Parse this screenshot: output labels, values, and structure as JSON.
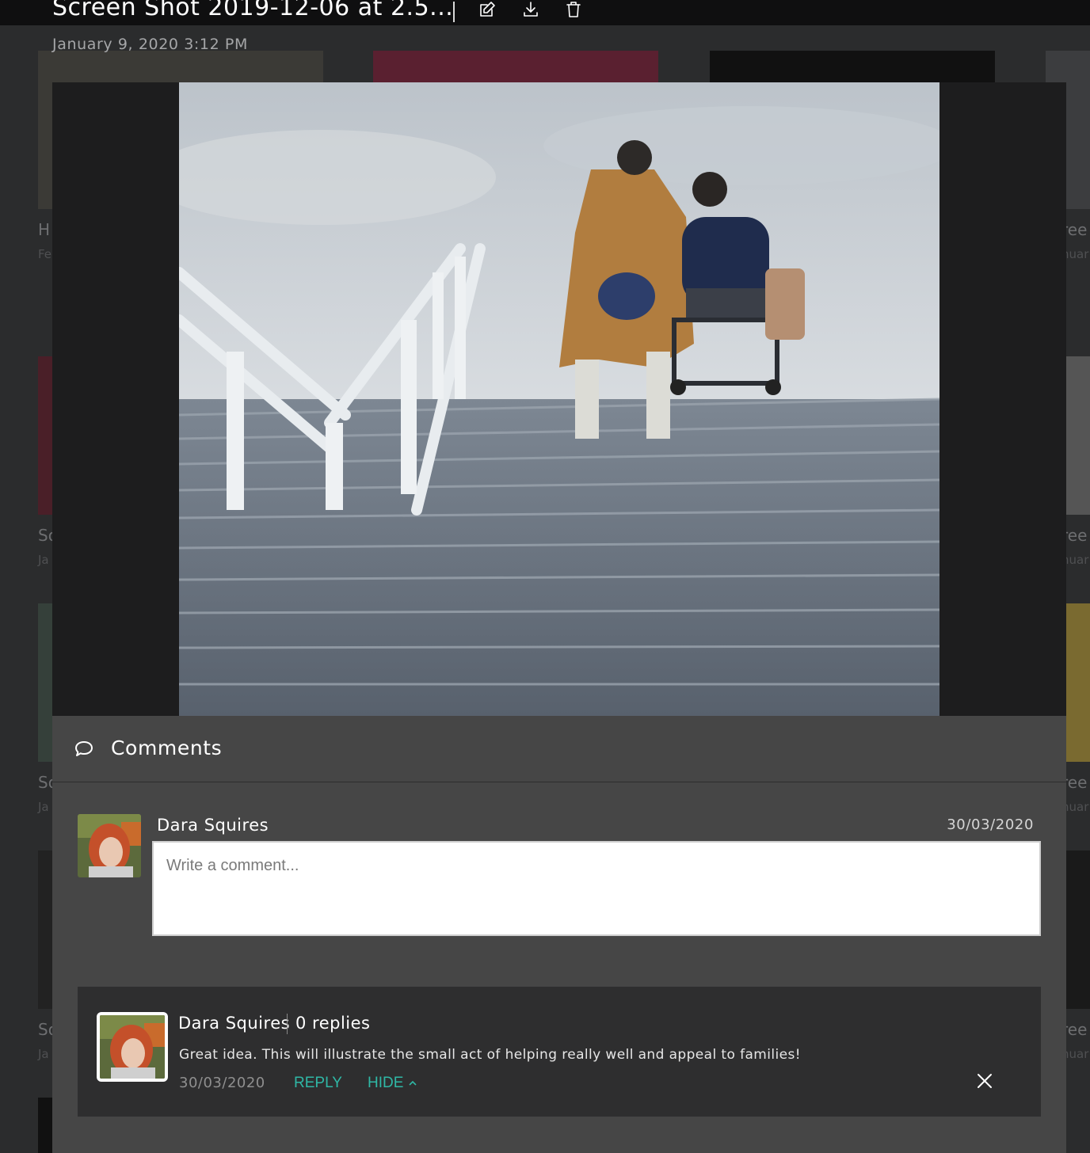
{
  "topbar": {
    "file_title": "Screen Shot 2019-12-06 at 2.5...",
    "edit_icon": "edit-icon",
    "download_icon": "download-icon",
    "delete_icon": "trash-icon"
  },
  "file": {
    "date": "January 9, 2020 3:12 PM"
  },
  "viewer": {
    "image_alt": "photo"
  },
  "comments": {
    "title": "Comments",
    "icon": "speech-bubble-icon",
    "composer": {
      "user_name": "Dara Squires",
      "date": "30/03/2020",
      "placeholder": "Write a comment..."
    },
    "items": [
      {
        "user_name": "Dara Squires",
        "replies_label": "0 replies",
        "text": "Great idea. This will illustrate the small act of helping really well and appeal to families!",
        "date": "30/03/2020",
        "reply_label": "REPLY",
        "hide_label": "HIDE"
      }
    ]
  },
  "background_gallery": {
    "left_labels": [
      "H",
      "Fe",
      "So",
      "Ja",
      "So",
      "Ja",
      "So",
      "Ja"
    ],
    "right_labels": [
      "ree",
      "nuar",
      "ree",
      "nuar",
      "ree",
      "nuar",
      "ree",
      "nuar"
    ]
  },
  "colors": {
    "accent": "#2fb8a6",
    "panel": "#464646",
    "card": "#2e2e2f",
    "topbar": "#0f0f10"
  }
}
